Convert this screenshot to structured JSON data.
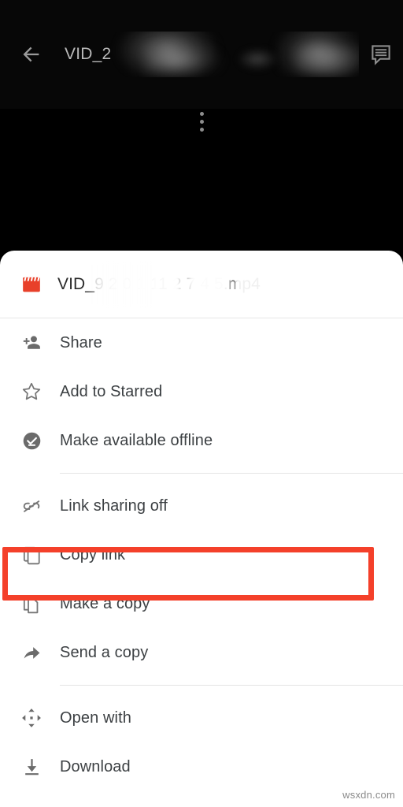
{
  "appbar": {
    "back_label": "Back",
    "title": "VID_2",
    "comment_label": "Comments",
    "overflow_label": "More options",
    "icon_back": "arrow-left-icon",
    "icon_comment": "comment-icon",
    "icon_overflow": "more-vertical-icon",
    "background_color": "#070707",
    "text_color": "#b9b9b9"
  },
  "sheet": {
    "file": {
      "name_prefix": "VID_",
      "name_fragment": "1",
      "name_suffix": ".mp4",
      "icon": "video-clapperboard-icon",
      "icon_color": "#e8402a"
    },
    "items": [
      {
        "label": "Share",
        "icon": "person-add-icon"
      },
      {
        "label": "Add to Starred",
        "icon": "star-outline-icon"
      },
      {
        "label": "Make available offline",
        "icon": "offline-check-icon"
      },
      {
        "label": "Link sharing off",
        "icon": "link-off-icon"
      },
      {
        "label": "Copy link",
        "icon": "copy-link-icon"
      },
      {
        "label": "Make a copy",
        "icon": "file-copy-icon"
      },
      {
        "label": "Send a copy",
        "icon": "send-arrow-icon"
      },
      {
        "label": "Open with",
        "icon": "open-with-icon"
      },
      {
        "label": "Download",
        "icon": "download-icon"
      }
    ],
    "background_color": "#ffffff",
    "label_color": "#3c4043"
  },
  "annotation": {
    "target_label": "Copy link",
    "color": "#f4402a"
  },
  "watermark": {
    "text": "wsxdn.com"
  }
}
